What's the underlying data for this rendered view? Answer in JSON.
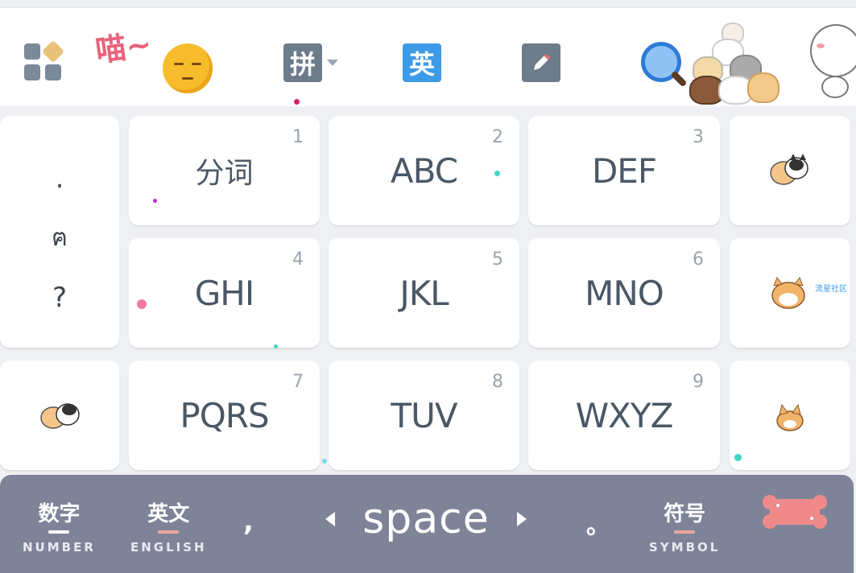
{
  "toolbar": {
    "meow_text": "喵~",
    "pinyin_label": "拼",
    "english_label": "英",
    "watermark_text": "流星社区"
  },
  "keypad": {
    "punctuation": [
      ".",
      "?"
    ],
    "keys": [
      {
        "number": "1",
        "label": "分词"
      },
      {
        "number": "2",
        "label": "ABC"
      },
      {
        "number": "3",
        "label": "DEF"
      },
      {
        "number": "4",
        "label": "GHI"
      },
      {
        "number": "5",
        "label": "JKL"
      },
      {
        "number": "6",
        "label": "MNO"
      },
      {
        "number": "7",
        "label": "PQRS"
      },
      {
        "number": "8",
        "label": "TUV"
      },
      {
        "number": "9",
        "label": "WXYZ"
      }
    ]
  },
  "bottom_bar": {
    "number": {
      "main": "数字",
      "sub": "NUMBER"
    },
    "english": {
      "main": "英文",
      "sub": "ENGLISH"
    },
    "comma": ",",
    "space": "space",
    "period": "。",
    "symbol": {
      "main": "符号",
      "sub": "SYMBOL"
    }
  },
  "colors": {
    "key_text": "#4a5866",
    "bottom_bar_bg": "#7f8398",
    "english_accent": "#3d9ae6",
    "toolbar_icon": "#6d7c8a",
    "mode_indicator": "#e8a7a0"
  },
  "icons": {
    "menu": "grid-icon",
    "emoji": "face-emoji-icon",
    "edit": "pencil-icon",
    "search": "magnifier-icon",
    "delete": "bone-backspace-icon"
  }
}
